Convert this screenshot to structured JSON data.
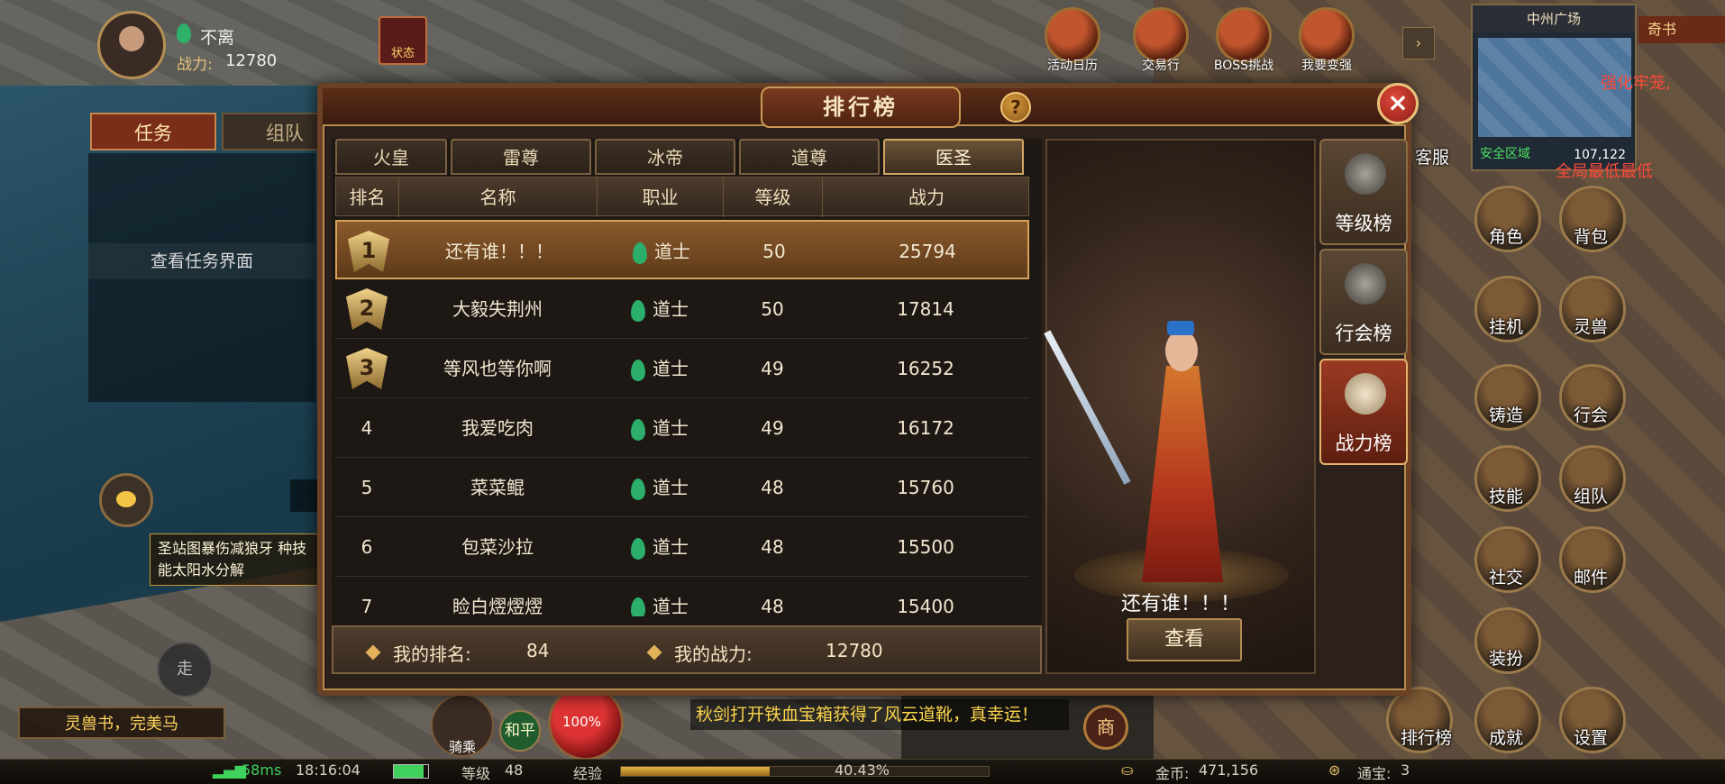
{
  "player": {
    "name": "不离",
    "power_label": "战力:",
    "power_value": "12780",
    "status_label": "状态"
  },
  "top_menu": [
    {
      "label": "活动日历",
      "icon": "calendar-icon"
    },
    {
      "label": "交易行",
      "icon": "scales-icon"
    },
    {
      "label": "BOSS挑战",
      "icon": "boss-icon"
    },
    {
      "label": "我要变强",
      "icon": "fist-icon"
    }
  ],
  "quick_book": "奇书",
  "minimap": {
    "title": "中州广场",
    "zone": "安全区域",
    "coords": "107,122"
  },
  "left_panel": {
    "tabs": [
      "任务",
      "组队"
    ],
    "view_task": "查看任务界面",
    "scroll_text": "圣站图暴伤减狼牙 种技能太阳水分解",
    "walk": "走",
    "quest_strip": "灵兽书，完美马"
  },
  "right_side": {
    "notice_left": "强化牢笼,",
    "notice_right": "全局最低最低",
    "service": "客服",
    "menu": [
      {
        "label": "角色",
        "icon": "character-icon"
      },
      {
        "label": "背包",
        "icon": "bag-icon"
      },
      {
        "label": "挂机",
        "icon": "auto-icon"
      },
      {
        "label": "灵兽",
        "icon": "beast-icon"
      },
      {
        "label": "铸造",
        "icon": "forge-icon"
      },
      {
        "label": "行会",
        "icon": "guild-icon"
      },
      {
        "label": "技能",
        "icon": "skill-icon"
      },
      {
        "label": "组队",
        "icon": "team-icon"
      },
      {
        "label": "社交",
        "icon": "social-icon"
      },
      {
        "label": "邮件",
        "icon": "mail-icon"
      },
      {
        "label": "装扮",
        "icon": "outfit-icon"
      },
      {
        "label": "排行榜",
        "icon": "ranking-icon"
      },
      {
        "label": "成就",
        "icon": "achievement-icon"
      },
      {
        "label": "设置",
        "icon": "settings-icon"
      }
    ]
  },
  "ranking": {
    "title": "排行榜",
    "class_tabs": [
      "火皇",
      "雷尊",
      "冰帝",
      "道尊",
      "医圣"
    ],
    "active_class_tab": 4,
    "columns": [
      "排名",
      "名称",
      "职业",
      "等级",
      "战力"
    ],
    "rows": [
      {
        "rank": "1",
        "name": "还有谁！！！",
        "class": "道士",
        "level": "50",
        "power": "25794"
      },
      {
        "rank": "2",
        "name": "大毅失荆州",
        "class": "道士",
        "level": "50",
        "power": "17814"
      },
      {
        "rank": "3",
        "name": "等风也等你啊",
        "class": "道士",
        "level": "49",
        "power": "16252"
      },
      {
        "rank": "4",
        "name": "我爱吃肉",
        "class": "道士",
        "level": "49",
        "power": "16172"
      },
      {
        "rank": "5",
        "name": "菜菜鲲",
        "class": "道士",
        "level": "48",
        "power": "15760"
      },
      {
        "rank": "6",
        "name": "包菜沙拉",
        "class": "道士",
        "level": "48",
        "power": "15500"
      },
      {
        "rank": "7",
        "name": "睑白熤熤熤",
        "class": "道士",
        "level": "48",
        "power": "15400"
      }
    ],
    "my_rank_label": "我的排名:",
    "my_rank_value": "84",
    "my_power_label": "我的战力:",
    "my_power_value": "12780",
    "selected_name": "还有谁！！！",
    "view_button": "查看",
    "rank_types": [
      {
        "label": "等级榜",
        "icon": "level-rank-icon"
      },
      {
        "label": "行会榜",
        "icon": "guild-rank-icon"
      },
      {
        "label": "战力榜",
        "icon": "power-rank-icon"
      }
    ],
    "active_rank_type": 2
  },
  "bottom": {
    "ping": "58ms",
    "time": "18:16:04",
    "level_label": "等级",
    "level_value": "48",
    "exp_label": "经验",
    "exp_percent": "40.43%",
    "exp_fraction": 0.4043,
    "gold_label": "金币:",
    "gold_value": "471,156",
    "coupon_label": "通宝:",
    "coupon_value": "3",
    "hp_percent": "100%",
    "peace": "和平",
    "ride": "骑乘",
    "shop": "商",
    "system_message": "秋剑打开铁血宝箱获得了风云道靴，真幸运！"
  }
}
